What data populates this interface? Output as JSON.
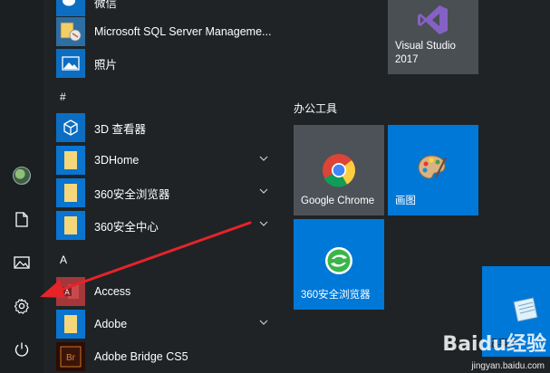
{
  "rail": {
    "items": [
      {
        "name": "user-avatar"
      },
      {
        "name": "documents-icon"
      },
      {
        "name": "pictures-icon"
      },
      {
        "name": "settings-icon"
      },
      {
        "name": "power-icon"
      }
    ]
  },
  "app_list": {
    "items": [
      {
        "label": "微信",
        "icon": "wechat-icon",
        "expandable": false
      },
      {
        "label": "Microsoft SQL Server Manageme...",
        "icon": "sql-server-icon",
        "expandable": false
      },
      {
        "label": "照片",
        "icon": "photos-icon",
        "expandable": false
      }
    ],
    "group_hash": "#",
    "hash_items": [
      {
        "label": "3D 查看器",
        "icon": "3d-viewer-icon",
        "expandable": false
      },
      {
        "label": "3DHome",
        "icon": "folder-icon",
        "expandable": true
      },
      {
        "label": "360安全浏览器",
        "icon": "folder-icon",
        "expandable": true
      },
      {
        "label": "360安全中心",
        "icon": "folder-icon",
        "expandable": true
      }
    ],
    "group_a": "A",
    "a_items": [
      {
        "label": "Access",
        "icon": "access-icon",
        "expandable": false
      },
      {
        "label": "Adobe",
        "icon": "folder-icon",
        "expandable": true
      },
      {
        "label": "Adobe Bridge CS5",
        "icon": "adobe-bridge-icon",
        "expandable": false
      }
    ]
  },
  "tiles": {
    "group_title": "办公工具",
    "visual_studio": {
      "line1": "Visual Studio",
      "line2": "2017"
    },
    "chrome": "Google Chrome",
    "paint": "画图",
    "browser360": "360安全浏览器",
    "notepad": "记事本"
  },
  "colors": {
    "tile_blue": "#0078d7",
    "tile_gray": "#4c5257",
    "annotation_arrow": "#e5242a"
  },
  "watermark": {
    "brand": "Baidu经验",
    "url": "jingyan.baidu.com"
  }
}
